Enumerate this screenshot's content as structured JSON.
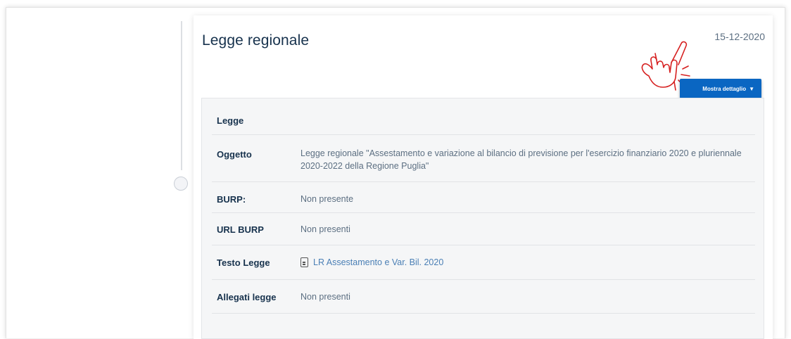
{
  "card": {
    "title": "Legge regionale",
    "date": "15-12-2020",
    "detail_button": "Mostra dettaglio",
    "detail_caret": "▼"
  },
  "rows": [
    {
      "label": "Legge",
      "value": ""
    },
    {
      "label": "Oggetto",
      "value": "Legge regionale \"Assestamento e variazione al bilancio di previsione per l'esercizio finanziario 2020 e pluriennale 2020-2022 della Regione Puglia\""
    },
    {
      "label": "BURP:",
      "value": "Non presente"
    },
    {
      "label": "URL BURP",
      "value": "Non presenti"
    },
    {
      "label": "Testo Legge",
      "value": "LR Assestamento e Var. Bil. 2020",
      "icon": "document-icon"
    },
    {
      "label": "Allegati legge",
      "value": "Non presenti"
    }
  ],
  "annotation": {
    "icon": "pointing-hand-icon",
    "color": "#d62020"
  },
  "colors": {
    "accent": "#0a66c2",
    "title": "#17324d",
    "muted": "#5c6f82",
    "link": "#4a7fb5"
  }
}
